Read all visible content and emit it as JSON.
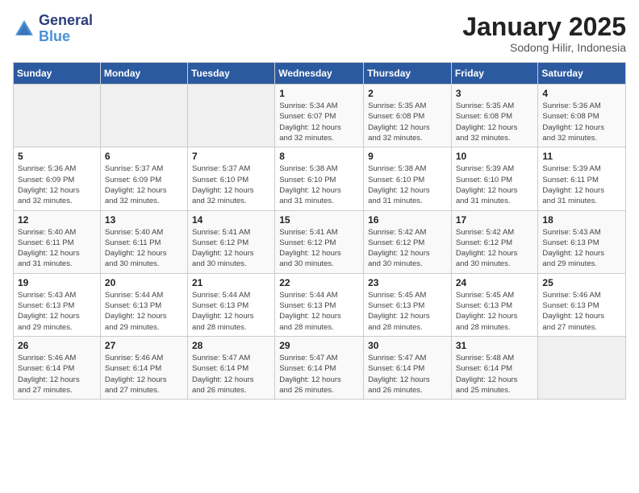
{
  "logo": {
    "line1": "General",
    "line2": "Blue"
  },
  "title": "January 2025",
  "subtitle": "Sodong Hilir, Indonesia",
  "weekdays": [
    "Sunday",
    "Monday",
    "Tuesday",
    "Wednesday",
    "Thursday",
    "Friday",
    "Saturday"
  ],
  "weeks": [
    [
      {
        "day": "",
        "info": ""
      },
      {
        "day": "",
        "info": ""
      },
      {
        "day": "",
        "info": ""
      },
      {
        "day": "1",
        "info": "Sunrise: 5:34 AM\nSunset: 6:07 PM\nDaylight: 12 hours\nand 32 minutes."
      },
      {
        "day": "2",
        "info": "Sunrise: 5:35 AM\nSunset: 6:08 PM\nDaylight: 12 hours\nand 32 minutes."
      },
      {
        "day": "3",
        "info": "Sunrise: 5:35 AM\nSunset: 6:08 PM\nDaylight: 12 hours\nand 32 minutes."
      },
      {
        "day": "4",
        "info": "Sunrise: 5:36 AM\nSunset: 6:08 PM\nDaylight: 12 hours\nand 32 minutes."
      }
    ],
    [
      {
        "day": "5",
        "info": "Sunrise: 5:36 AM\nSunset: 6:09 PM\nDaylight: 12 hours\nand 32 minutes."
      },
      {
        "day": "6",
        "info": "Sunrise: 5:37 AM\nSunset: 6:09 PM\nDaylight: 12 hours\nand 32 minutes."
      },
      {
        "day": "7",
        "info": "Sunrise: 5:37 AM\nSunset: 6:10 PM\nDaylight: 12 hours\nand 32 minutes."
      },
      {
        "day": "8",
        "info": "Sunrise: 5:38 AM\nSunset: 6:10 PM\nDaylight: 12 hours\nand 31 minutes."
      },
      {
        "day": "9",
        "info": "Sunrise: 5:38 AM\nSunset: 6:10 PM\nDaylight: 12 hours\nand 31 minutes."
      },
      {
        "day": "10",
        "info": "Sunrise: 5:39 AM\nSunset: 6:10 PM\nDaylight: 12 hours\nand 31 minutes."
      },
      {
        "day": "11",
        "info": "Sunrise: 5:39 AM\nSunset: 6:11 PM\nDaylight: 12 hours\nand 31 minutes."
      }
    ],
    [
      {
        "day": "12",
        "info": "Sunrise: 5:40 AM\nSunset: 6:11 PM\nDaylight: 12 hours\nand 31 minutes."
      },
      {
        "day": "13",
        "info": "Sunrise: 5:40 AM\nSunset: 6:11 PM\nDaylight: 12 hours\nand 30 minutes."
      },
      {
        "day": "14",
        "info": "Sunrise: 5:41 AM\nSunset: 6:12 PM\nDaylight: 12 hours\nand 30 minutes."
      },
      {
        "day": "15",
        "info": "Sunrise: 5:41 AM\nSunset: 6:12 PM\nDaylight: 12 hours\nand 30 minutes."
      },
      {
        "day": "16",
        "info": "Sunrise: 5:42 AM\nSunset: 6:12 PM\nDaylight: 12 hours\nand 30 minutes."
      },
      {
        "day": "17",
        "info": "Sunrise: 5:42 AM\nSunset: 6:12 PM\nDaylight: 12 hours\nand 30 minutes."
      },
      {
        "day": "18",
        "info": "Sunrise: 5:43 AM\nSunset: 6:13 PM\nDaylight: 12 hours\nand 29 minutes."
      }
    ],
    [
      {
        "day": "19",
        "info": "Sunrise: 5:43 AM\nSunset: 6:13 PM\nDaylight: 12 hours\nand 29 minutes."
      },
      {
        "day": "20",
        "info": "Sunrise: 5:44 AM\nSunset: 6:13 PM\nDaylight: 12 hours\nand 29 minutes."
      },
      {
        "day": "21",
        "info": "Sunrise: 5:44 AM\nSunset: 6:13 PM\nDaylight: 12 hours\nand 28 minutes."
      },
      {
        "day": "22",
        "info": "Sunrise: 5:44 AM\nSunset: 6:13 PM\nDaylight: 12 hours\nand 28 minutes."
      },
      {
        "day": "23",
        "info": "Sunrise: 5:45 AM\nSunset: 6:13 PM\nDaylight: 12 hours\nand 28 minutes."
      },
      {
        "day": "24",
        "info": "Sunrise: 5:45 AM\nSunset: 6:13 PM\nDaylight: 12 hours\nand 28 minutes."
      },
      {
        "day": "25",
        "info": "Sunrise: 5:46 AM\nSunset: 6:13 PM\nDaylight: 12 hours\nand 27 minutes."
      }
    ],
    [
      {
        "day": "26",
        "info": "Sunrise: 5:46 AM\nSunset: 6:14 PM\nDaylight: 12 hours\nand 27 minutes."
      },
      {
        "day": "27",
        "info": "Sunrise: 5:46 AM\nSunset: 6:14 PM\nDaylight: 12 hours\nand 27 minutes."
      },
      {
        "day": "28",
        "info": "Sunrise: 5:47 AM\nSunset: 6:14 PM\nDaylight: 12 hours\nand 26 minutes."
      },
      {
        "day": "29",
        "info": "Sunrise: 5:47 AM\nSunset: 6:14 PM\nDaylight: 12 hours\nand 26 minutes."
      },
      {
        "day": "30",
        "info": "Sunrise: 5:47 AM\nSunset: 6:14 PM\nDaylight: 12 hours\nand 26 minutes."
      },
      {
        "day": "31",
        "info": "Sunrise: 5:48 AM\nSunset: 6:14 PM\nDaylight: 12 hours\nand 25 minutes."
      },
      {
        "day": "",
        "info": ""
      }
    ]
  ]
}
